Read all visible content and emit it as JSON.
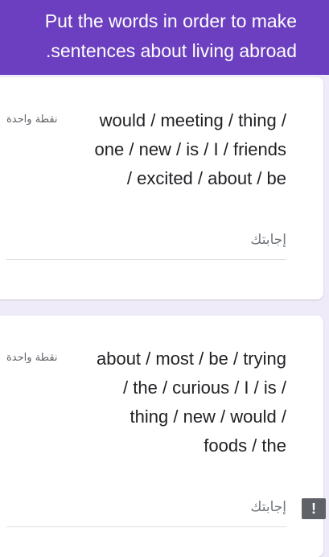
{
  "header": {
    "line1": "Put the words in order to make",
    "line2": ".sentences about living abroad",
    "color": "#6b3fbf"
  },
  "questions": [
    {
      "points": "نقطة واحدة",
      "lines": [
        "would / meeting / thing /",
        "one / new / is / I / friends",
        "/ excited / about / be"
      ],
      "answer_placeholder": "إجابتك"
    },
    {
      "points": "نقطة واحدة",
      "lines": [
        "about / most / be / trying",
        "/ the / curious / I / is /",
        "thing / new / would /",
        "foods / the"
      ],
      "answer_placeholder": "إجابتك"
    }
  ],
  "feedback_button": {
    "label": "!",
    "icon": "exclamation-icon"
  }
}
